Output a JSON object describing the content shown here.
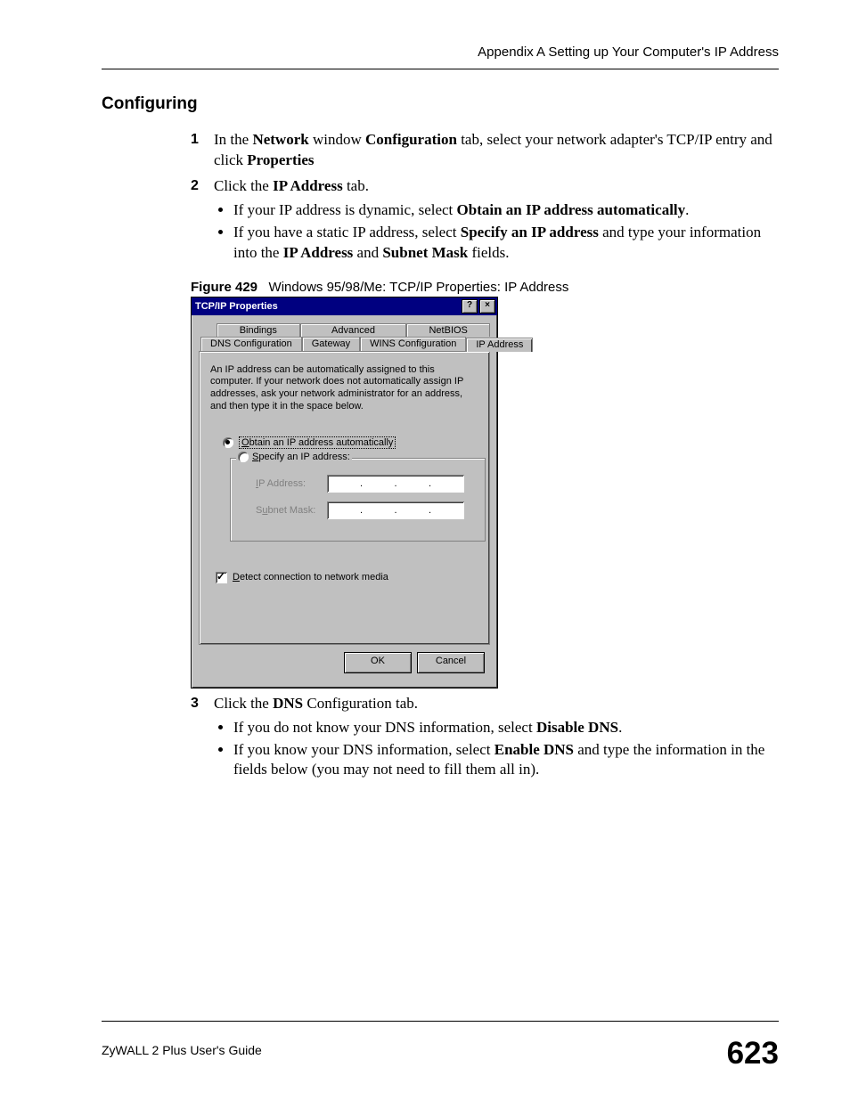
{
  "header": {
    "running_head": "Appendix A Setting up Your Computer's IP Address"
  },
  "section_title": "Configuring",
  "steps": {
    "s1": {
      "num": "1",
      "t1": "In the ",
      "b1": "Network",
      "t2": " window ",
      "b2": "Configuration",
      "t3": " tab, select your network adapter's TCP/IP entry and click ",
      "b3": "Properties"
    },
    "s2": {
      "num": "2",
      "t1": "Click the ",
      "b1": "IP Address",
      "t2": " tab.",
      "bul1_t1": "If your IP address is dynamic, select ",
      "bul1_b1": "Obtain an IP address automatically",
      "bul1_t2": ".",
      "bul2_t1": "If you have a static IP address, select ",
      "bul2_b1": "Specify an IP address",
      "bul2_t2": " and type your information into the ",
      "bul2_b2": "IP Address",
      "bul2_t3": " and ",
      "bul2_b3": "Subnet Mask",
      "bul2_t4": " fields."
    },
    "s3": {
      "num": "3",
      "t1": "Click the ",
      "b1": "DNS",
      "t2": " Configuration tab.",
      "bul1_t1": "If you do not know your DNS information, select ",
      "bul1_b1": "Disable DNS",
      "bul1_t2": ".",
      "bul2_t1": "If you know your DNS information, select ",
      "bul2_b1": "Enable DNS",
      "bul2_t2": " and type the information in the fields below (you may not need to fill them all in)."
    }
  },
  "figure": {
    "label": "Figure 429",
    "caption": "Windows 95/98/Me: TCP/IP Properties: IP Address"
  },
  "dialog": {
    "title": "TCP/IP Properties",
    "help_btn": "?",
    "close_btn": "×",
    "tabs": {
      "bindings": "Bindings",
      "advanced": "Advanced",
      "netbios": "NetBIOS",
      "dnsconfig": "DNS Configuration",
      "gateway": "Gateway",
      "winsconfig": "WINS Configuration",
      "ipaddress": "IP Address"
    },
    "desc": "An IP address can be automatically assigned to this computer. If your network does not automatically assign IP addresses, ask your network administrator for an address, and then type it in the space below.",
    "radio1_u": "O",
    "radio1_rest": "btain an IP address automatically",
    "radio2_u": "S",
    "radio2_rest": "pecify an IP address:",
    "ip_u": "I",
    "ip_label_rest": "P Address:",
    "subnet_label_s": "S",
    "subnet_label_u": "u",
    "subnet_label_rest": "bnet Mask:",
    "detect_u": "D",
    "detect_rest": "etect connection to network media",
    "ok": "OK",
    "cancel": "Cancel"
  },
  "footer": {
    "guide": "ZyWALL 2 Plus User's Guide",
    "page": "623"
  }
}
